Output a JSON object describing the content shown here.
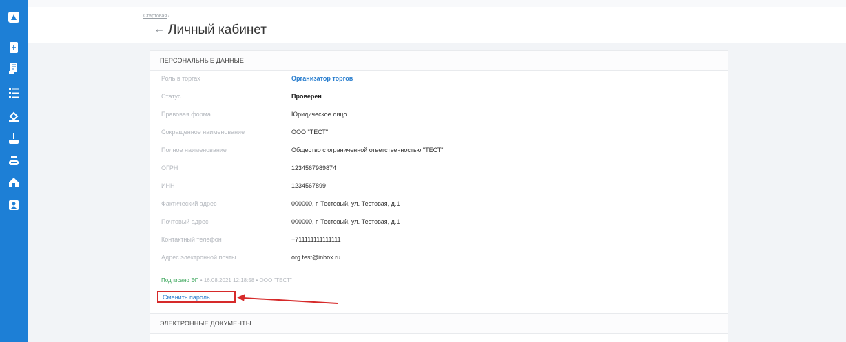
{
  "breadcrumb": {
    "home": "Стартовая",
    "separator": "/"
  },
  "header": {
    "back_icon": "←",
    "title": "Личный кабинет"
  },
  "sidebar": {
    "items": [
      {
        "icon": "logo-icon"
      },
      {
        "icon": "document-add-icon"
      },
      {
        "icon": "scroll-icon"
      },
      {
        "icon": "list-icon"
      },
      {
        "icon": "gavel-icon"
      },
      {
        "icon": "auction-icon"
      },
      {
        "icon": "auction-alt-icon"
      },
      {
        "icon": "home-icon"
      },
      {
        "icon": "contacts-icon"
      }
    ]
  },
  "personal": {
    "section_title": "ПЕРСОНАЛЬНЫЕ ДАННЫЕ",
    "rows": [
      {
        "label": "Роль в торгах",
        "value": "Организатор торгов"
      },
      {
        "label": "Статус",
        "value": "Проверен"
      },
      {
        "label": "Правовая форма",
        "value": "Юридическое лицо"
      },
      {
        "label": "Сокращенное наименование",
        "value": "ООО \"ТЕСТ\""
      },
      {
        "label": "Полное наименование",
        "value": "Общество с ограниченной ответственностью \"ТЕСТ\""
      },
      {
        "label": "ОГРН",
        "value": "1234567989874"
      },
      {
        "label": "ИНН",
        "value": "1234567899"
      },
      {
        "label": "Фактический адрес",
        "value": "000000, г. Тестовый, ул. Тестовая, д.1"
      },
      {
        "label": "Почтовый адрес",
        "value": "000000, г. Тестовый, ул. Тестовая, д.1"
      },
      {
        "label": "Контактный телефон",
        "value": "+711111111111111"
      },
      {
        "label": "Адрес электронной почты",
        "value": "org.test@inbox.ru"
      }
    ],
    "signed": {
      "label": "Подписано ЭП",
      "date": "16.08.2021 12:18:58",
      "org": "ООО \"ТЕСТ\"",
      "separator": "•"
    },
    "change_password": "Сменить пароль"
  },
  "documents": {
    "section_title": "ЭЛЕКТРОННЫЕ ДОКУМЕНТЫ"
  },
  "colors": {
    "sidebar": "#1d7fd6",
    "link": "#2b7fcf",
    "signed": "#3aa65a",
    "annotation": "#d62a2a"
  }
}
